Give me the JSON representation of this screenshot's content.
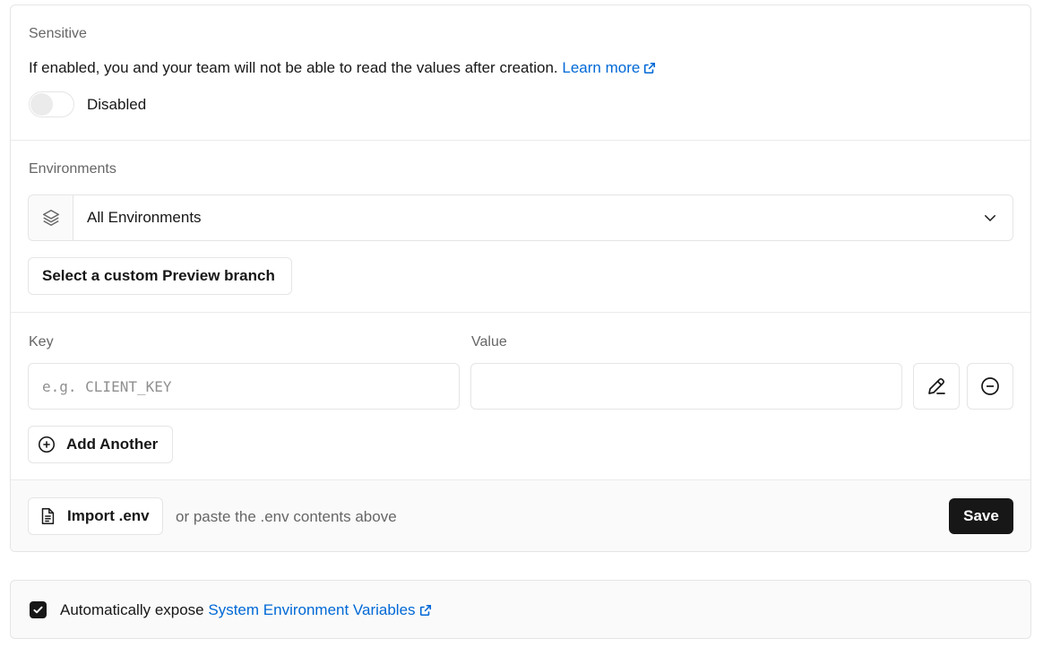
{
  "sensitive": {
    "label": "Sensitive",
    "description": "If enabled, you and your team will not be able to read the values after creation.",
    "learn_more": "Learn more",
    "toggle_state": "Disabled"
  },
  "environments": {
    "label": "Environments",
    "selected": "All Environments",
    "custom_branch_button": "Select a custom Preview branch"
  },
  "kv": {
    "key_label": "Key",
    "value_label": "Value",
    "key_placeholder": "e.g. CLIENT_KEY",
    "key_value": "",
    "value_value": "",
    "add_another": "Add Another"
  },
  "footer": {
    "import_label": "Import .env",
    "hint": "or paste the .env contents above",
    "save_label": "Save"
  },
  "system_vars": {
    "checked": true,
    "prefix": "Automatically expose",
    "link": "System Environment Variables"
  }
}
